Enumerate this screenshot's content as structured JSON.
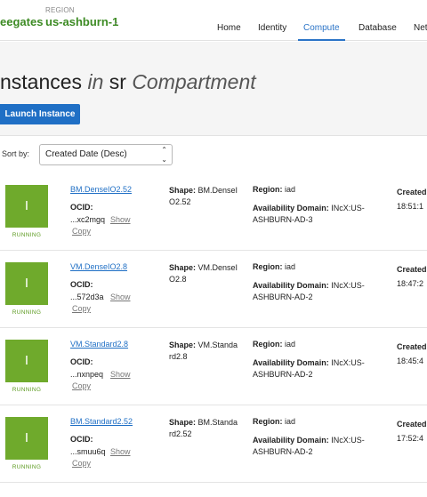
{
  "header": {
    "tenant": "eegates",
    "region_label": "REGION",
    "region_value": "us-ashburn-1",
    "region_caret": "⌄",
    "nav": [
      {
        "label": "Home",
        "active": false
      },
      {
        "label": "Identity",
        "active": false
      },
      {
        "label": "Compute",
        "active": true
      },
      {
        "label": "Database",
        "active": false
      },
      {
        "label": "Net",
        "active": false
      }
    ]
  },
  "page": {
    "title_prefix": "nstances",
    "title_in": "in",
    "title_compartment": "sr",
    "title_suffix": "Compartment",
    "launch_button": "Launch Instance"
  },
  "sort": {
    "label": "Sort by:",
    "selected": "Created Date (Desc)",
    "caret": "⌃⌄"
  },
  "instances": [
    {
      "icon_letter": "I",
      "state": "RUNNING",
      "name": "BM.DenseIO2.52",
      "ocid_label": "OCID:",
      "ocid": "...xc2mgq",
      "show": "Show",
      "copy": "Copy",
      "shape_label": "Shape:",
      "shape": "BM.DenseIO2.52",
      "region_label": "Region:",
      "region": "iad",
      "ad_label": "Availability Domain:",
      "ad": "INcX:US-ASHBURN-AD-3",
      "created_label": "Created",
      "created": "18:51:1"
    },
    {
      "icon_letter": "I",
      "state": "RUNNING",
      "name": "VM.DenseIO2.8",
      "ocid_label": "OCID:",
      "ocid": "...572d3a",
      "show": "Show",
      "copy": "Copy",
      "shape_label": "Shape:",
      "shape": "VM.DenseIO2.8",
      "region_label": "Region:",
      "region": "iad",
      "ad_label": "Availability Domain:",
      "ad": "INcX:US-ASHBURN-AD-2",
      "created_label": "Created",
      "created": "18:47:2"
    },
    {
      "icon_letter": "I",
      "state": "RUNNING",
      "name": "VM.Standard2.8",
      "ocid_label": "OCID:",
      "ocid": "...nxnpeq",
      "show": "Show",
      "copy": "Copy",
      "shape_label": "Shape:",
      "shape": "VM.Standard2.8",
      "region_label": "Region:",
      "region": "iad",
      "ad_label": "Availability Domain:",
      "ad": "INcX:US-ASHBURN-AD-2",
      "created_label": "Created",
      "created": "18:45:4"
    },
    {
      "icon_letter": "I",
      "state": "RUNNING",
      "name": "BM.Standard2.52",
      "ocid_label": "OCID:",
      "ocid": "...smuu6q",
      "show": "Show",
      "copy": "Copy",
      "shape_label": "Shape:",
      "shape": "BM.Standard2.52",
      "region_label": "Region:",
      "region": "iad",
      "ad_label": "Availability Domain:",
      "ad": "INcX:US-ASHBURN-AD-2",
      "created_label": "Created",
      "created": "17:52:4"
    }
  ],
  "colors": {
    "brand_green": "#3d8b24",
    "running_green": "#6faa2c",
    "link_blue": "#1f6fc5",
    "active_nav": "#2b74c7"
  }
}
